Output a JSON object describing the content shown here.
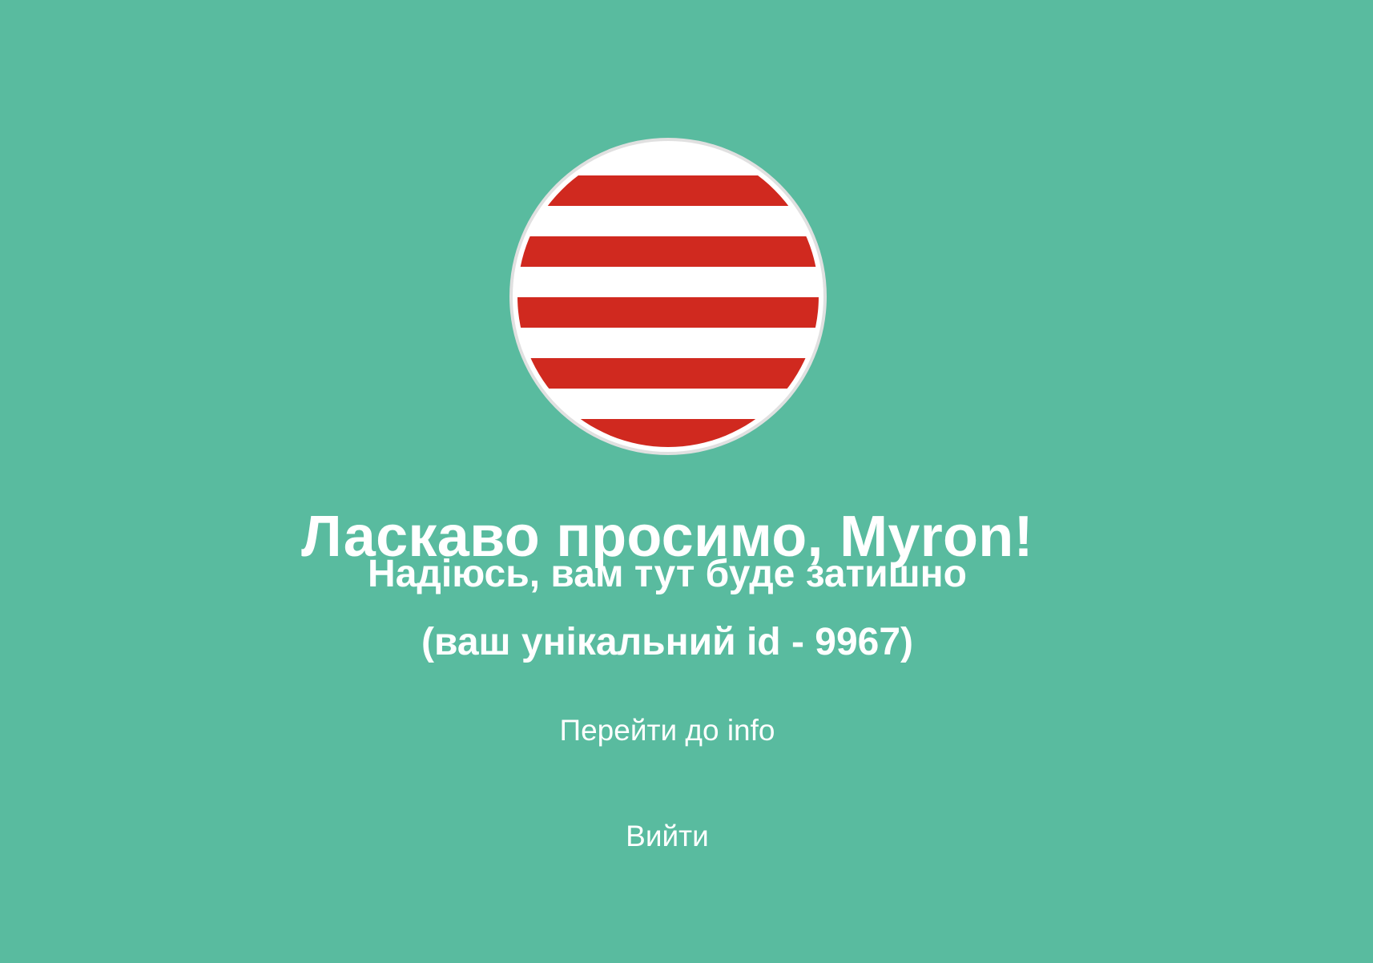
{
  "colors": {
    "background": "#59bb9f",
    "text": "#ffffff",
    "avatar_stripe_red": "#d0291f",
    "avatar_stripe_white": "#ffffff",
    "avatar_border": "#e0e0e0"
  },
  "avatar": {
    "icon": "red-white-striped-circle-icon"
  },
  "welcome": {
    "title": "Ласкаво просимо, Myron!",
    "subtitle": "Надіюсь, вам тут буде затишно",
    "unique_id_text": "(ваш унікальний id - 9967)"
  },
  "links": {
    "info_label": "Перейти до info",
    "logout_label": "Вийти"
  }
}
